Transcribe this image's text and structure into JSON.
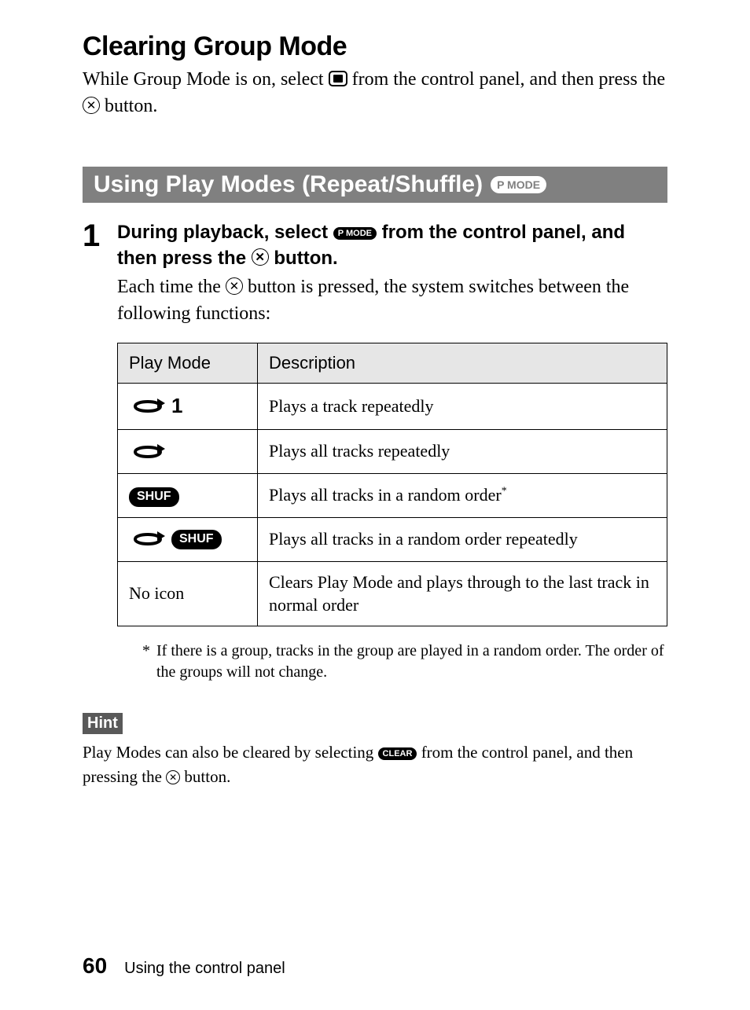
{
  "clearing": {
    "heading": "Clearing Group Mode",
    "intro_before_stop": "While Group Mode is on, select ",
    "intro_after_stop_before_x": " from the control panel, and then press the ",
    "intro_after_x": " button."
  },
  "section": {
    "title": "Using Play Modes (Repeat/Shuffle)",
    "badge": "P MODE"
  },
  "step": {
    "num": "1",
    "title_before_pmode": "During playback, select ",
    "title_after_pmode_before_x": " from the control panel, and then press the ",
    "title_after_x": " button.",
    "desc_before_x": "Each time the ",
    "desc_after_x": " button is pressed, the system switches between the following functions:"
  },
  "table": {
    "head_mode": "Play Mode",
    "head_desc": "Description",
    "rows": [
      {
        "mode_label": "repeat-1",
        "desc": "Plays a track repeatedly"
      },
      {
        "mode_label": "repeat-all",
        "desc": "Plays all tracks repeatedly"
      },
      {
        "mode_label": "shuf",
        "desc": "Plays all tracks in a random order",
        "sup": "*"
      },
      {
        "mode_label": "repeat-shuf",
        "desc": "Plays all tracks in a random order repeatedly"
      },
      {
        "mode_label": "none",
        "mode_text": "No icon",
        "desc": "Clears Play Mode and plays through to the last track in normal order"
      }
    ]
  },
  "footnote": {
    "mark": "*",
    "text": "If there is a group, tracks in the group are played in a random order. The order of the groups will not change."
  },
  "hint": {
    "badge": "Hint",
    "text_before_clear": "Play Modes can also be cleared by selecting ",
    "clear_label": "CLEAR",
    "text_after_clear_before_x": " from the control panel, and then pressing the ",
    "text_after_x": " button."
  },
  "footer": {
    "page": "60",
    "label": "Using the control panel"
  },
  "pmode_label": "P MODE",
  "shuf_label": "SHUF"
}
